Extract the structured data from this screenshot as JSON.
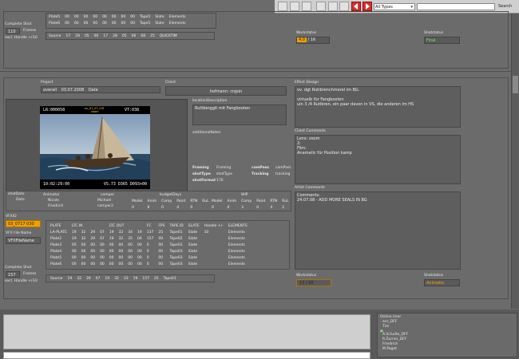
{
  "toolbar": {
    "types_select": "All Types",
    "search_value": "",
    "search_label": "Search"
  },
  "top_partial": {
    "rows": [
      [
        "Plate5",
        "00",
        "00",
        "00",
        "00",
        "00",
        "00",
        "00",
        "00",
        "",
        "",
        "Tape5",
        "Slate",
        "",
        "Elements"
      ],
      [
        "Plate6",
        "00",
        "00",
        "00",
        "00",
        "00",
        "00",
        "00",
        "00",
        "",
        "",
        "Tape5",
        "Slate",
        "",
        "Elements"
      ]
    ],
    "source_row": [
      "Source",
      "17",
      "28",
      "05",
      "00",
      "17",
      "28",
      "05",
      "06",
      "08",
      "25",
      "QUICKTIM"
    ],
    "complete_shot_label": "Complete Shot",
    "complete_shot_value": "110",
    "frames_label": "Frames",
    "handle_label": "excl. Handle +/-",
    "handle_value": "10",
    "workstatus_label": "Workstatus",
    "workstatus_value": "4.0",
    "workstatus_total": "/ 16",
    "shotstatus_label": "Shotstatus",
    "shotstatus_value": "Final"
  },
  "record": {
    "project_label": "Project",
    "project_value": "overall",
    "date_value": "03.07.2008",
    "date_label": "Date",
    "client_label": "Client",
    "client_value": "hofmann: crgsin",
    "effect_label": "Effect Design",
    "effect_text": "ov. dgt Rutibrenchmerel im BG.\n\nvirtuelb für Fangbooten\nuin 3 /4 Rutibren, ein paar davon in VS, die anderen im HS",
    "video": {
      "tc_left": "LR:000058",
      "tc_right": "VT:038",
      "clip_name": "ov_01_07_03f",
      "clip_sub": "zoom",
      "tc_bottom_left": "10:02:29:00",
      "tc_bottom_right": "VS.73 D365 D093+00"
    },
    "location_label": "locationDescription",
    "location_value": "Ruttberggit mit Fangbooten",
    "additional_label": "additionalNotes",
    "framing_label": "Framing",
    "framing_value": "Framing",
    "campass_label": "camPass",
    "campass_value": "camPass",
    "shottype_label": "shotType",
    "shottype_value": "shotType",
    "tracking_label": "Tracking",
    "tracking_value": "tracking",
    "shotformat_label": "shotFormat",
    "shotformat_value": "176",
    "client_comments_label": "Client Comments",
    "client_comments": "Lens: zoom\n2:\nFilm:\nAnamatic für Position kamp",
    "artist_comments_label": "Artist Comments",
    "artist_comments": "Comments:\n24.07.08 - ADD MORE SEALS IN BG",
    "shotdate_label": "shotDate",
    "shotdate_value": "Date",
    "animator_label": "Animator",
    "animator_values": [
      "Nicole",
      "Friedrich"
    ],
    "comper_label": "comper",
    "comper_values": [
      "Michael",
      "comper2"
    ],
    "budget_label": "budgetDays",
    "wip_label": "WIP",
    "budget_headers": [
      "Model",
      "Anim",
      "Comp",
      "Paint",
      "RTN",
      "RuL"
    ],
    "budget_values": [
      "0",
      "8",
      "0",
      "4",
      "0",
      ""
    ],
    "wip_values": [
      "0",
      "0",
      "3",
      "0",
      "4",
      "2"
    ],
    "vfxid_label": "VFXID",
    "vfxid_value": "03_0717 030",
    "vfxfile_label": "VFX File Name",
    "vfxfile_value": "VFXFileName",
    "complete_shot_label": "Complete Shot",
    "complete_shot_value": "157",
    "frames_label": "Frames",
    "handle_label": "excl. Handle +/-",
    "handle_value": "10",
    "plate_headers": [
      "PLATE",
      "LTC IN",
      "",
      "",
      "",
      "LTC OUT",
      "",
      "",
      "",
      "FC",
      "FPS",
      "TAPE ID",
      "SLATE",
      "Handle +/-",
      "ELEMENTS"
    ],
    "plate_rows": [
      [
        "LA-PLATE",
        "19",
        "32",
        "29",
        "07",
        "19",
        "32",
        "34",
        "19",
        "137",
        "25",
        "Tape01",
        "Slate",
        "10",
        "Elements"
      ],
      [
        "Plate2",
        "19",
        "32",
        "29",
        "07",
        "19",
        "32",
        "35",
        "04",
        "157",
        "00",
        "Tape02",
        "Slate",
        "",
        "Elements"
      ],
      [
        "Plate3",
        "00",
        "00",
        "00",
        "00",
        "00",
        "00",
        "00",
        "00",
        "0",
        "00",
        "Tape03",
        "Slate",
        "",
        "Elements"
      ],
      [
        "Plate4",
        "00",
        "00",
        "00",
        "00",
        "00",
        "00",
        "00",
        "00",
        "0",
        "00",
        "Tape03",
        "Slate",
        "",
        "Elements"
      ],
      [
        "Plate5",
        "00",
        "00",
        "00",
        "00",
        "00",
        "00",
        "00",
        "00",
        "0",
        "00",
        "Tape03",
        "Slate",
        "",
        "Elements"
      ],
      [
        "Plate6",
        "00",
        "00",
        "00",
        "00",
        "00",
        "00",
        "00",
        "00",
        "0",
        "00",
        "Tape03",
        "Slate",
        "",
        "Elements"
      ]
    ],
    "source_row": [
      "Source",
      "19",
      "32",
      "29",
      "07",
      "19",
      "32",
      "33",
      "19",
      "157",
      "25",
      "Tape01"
    ],
    "workstatus_label": "Workstatus",
    "workstatus_value": "17 / 20",
    "shotstatus_label": "Shotstatus",
    "shotstatus_value": "Animatio"
  },
  "online_users": {
    "title": "Online User",
    "users": [
      "ecs_DFF",
      "Tim",
      "A.Schulte_DFF",
      "R.Zurner_DFF",
      "Friedrich",
      "M.Paget"
    ]
  },
  "colors": {
    "background": "#6b6b6b",
    "accent_orange": "#f0a000",
    "status_green": "#7ddc6a",
    "arrow_red": "#d03030"
  }
}
